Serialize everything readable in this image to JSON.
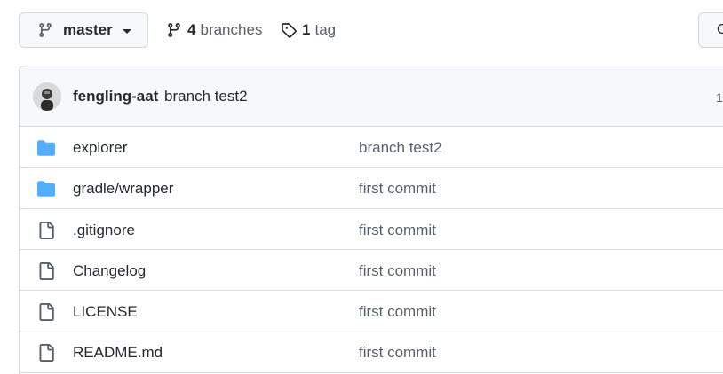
{
  "branch_selector": {
    "label": "master",
    "icon": "git-branch-icon"
  },
  "branches": {
    "count": "4",
    "label": "branches",
    "icon": "git-branch-icon"
  },
  "tags": {
    "count": "1",
    "label": "tag",
    "icon": "tag-icon"
  },
  "right_button": {
    "label": "C"
  },
  "latest_commit": {
    "author": "fengling-aat",
    "message": "branch test2",
    "right_text": "1"
  },
  "colors": {
    "folder": "#54aeff",
    "file": "#57606a",
    "border": "#d0d7de"
  },
  "files": [
    {
      "type": "folder",
      "icon": "folder-icon",
      "name": "explorer",
      "commit": "branch test2"
    },
    {
      "type": "folder",
      "icon": "folder-icon",
      "name": "gradle/wrapper",
      "commit": "first commit"
    },
    {
      "type": "file",
      "icon": "file-icon",
      "name": ".gitignore",
      "commit": "first commit"
    },
    {
      "type": "file",
      "icon": "file-icon",
      "name": "Changelog",
      "commit": "first commit"
    },
    {
      "type": "file",
      "icon": "file-icon",
      "name": "LICENSE",
      "commit": "first commit"
    },
    {
      "type": "file",
      "icon": "file-icon",
      "name": "README.md",
      "commit": "first commit"
    }
  ]
}
